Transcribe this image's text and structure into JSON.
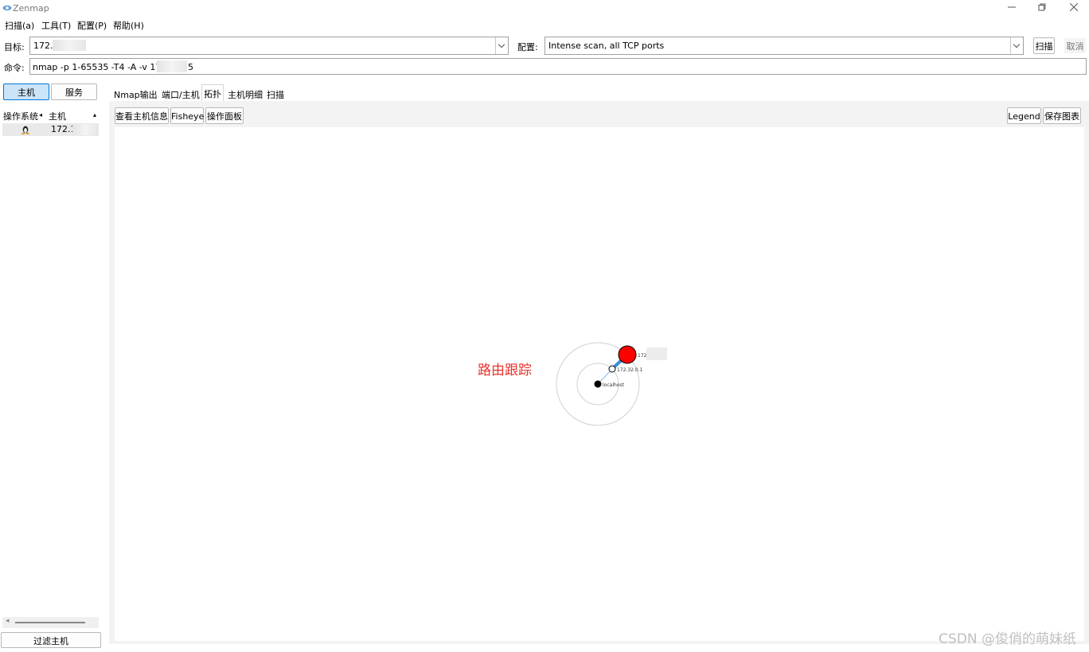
{
  "window": {
    "title": "Zenmap"
  },
  "menu": [
    "扫描(a)",
    "工具(T)",
    "配置(P)",
    "帮助(H)"
  ],
  "target": {
    "label": "目标:",
    "value": "172."
  },
  "profile": {
    "label": "配置:",
    "value": "Intense scan, all TCP ports"
  },
  "scan_button": "扫描",
  "cancel_button": "取消",
  "command": {
    "label": "命令:",
    "value": "nmap -p 1-65535 -T4 -A -v 172.",
    "suffix": "5"
  },
  "view_toggle": {
    "hosts": "主机",
    "services": "服务"
  },
  "host_list": {
    "col_os": "操作系统",
    "col_host": "主机",
    "rows": [
      {
        "host": "172.1"
      }
    ]
  },
  "filter_button": "过滤主机",
  "tabs": [
    "Nmap输出",
    "端口/主机",
    "拓扑",
    "主机明细",
    "扫描"
  ],
  "active_tab": "拓扑",
  "toolbar": {
    "host_info": "查看主机信息",
    "fisheye": "Fisheye",
    "controls": "操作面板",
    "legend": "Legend",
    "save": "保存图表"
  },
  "topology": {
    "nodes": [
      {
        "label": "localhost",
        "ring": 0
      },
      {
        "label": "172.32.0.1",
        "ring": 1
      },
      {
        "label": "172.",
        "ring": 2,
        "color": "#ff0000"
      }
    ],
    "annotation": "路由跟踪"
  },
  "watermark": "CSDN @俊俏的萌妹纸"
}
